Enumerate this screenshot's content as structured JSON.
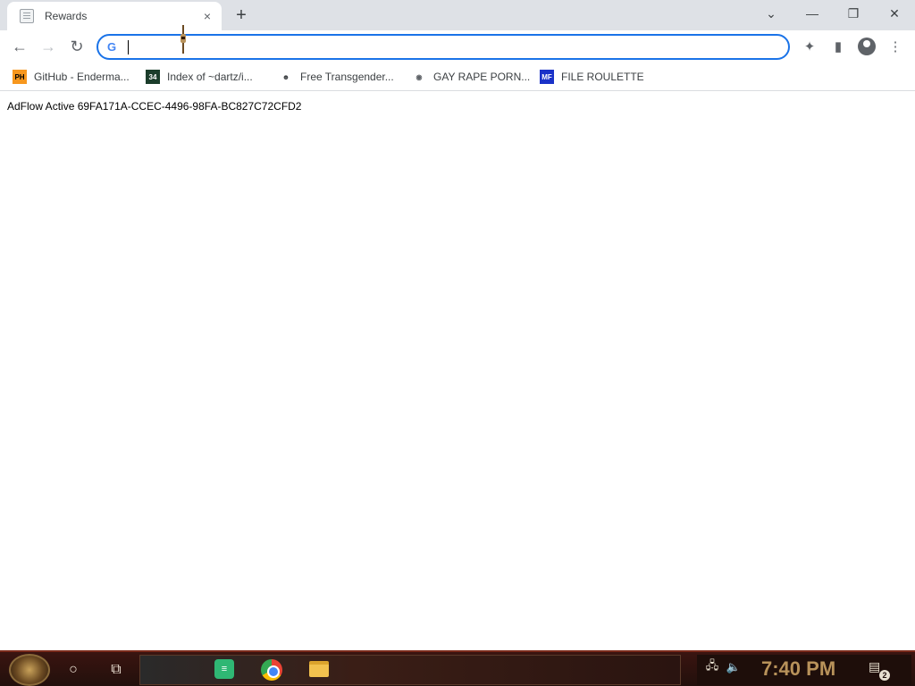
{
  "browser": {
    "tab": {
      "title": "Rewards",
      "close_icon": "×"
    },
    "new_tab_icon": "+",
    "window_controls": {
      "tab_search": "⌄",
      "minimize": "—",
      "restore": "❐",
      "close": "✕"
    },
    "toolbar": {
      "back_icon": "←",
      "forward_icon": "→",
      "reload_icon": "↻",
      "omnibox": {
        "value": "",
        "placeholder": ""
      },
      "extensions_icon": "✦",
      "side_panel_icon": "▮",
      "menu_icon": "⋮"
    },
    "bookmarks": [
      {
        "label": "GitHub - Enderma...",
        "icon_text": "PH",
        "icon_bg": "#f7971e",
        "icon_fg": "#000000"
      },
      {
        "label": "Index of ~dartz/i...",
        "icon_text": "34",
        "icon_bg": "#1b3d2b",
        "icon_fg": "#ffffff"
      },
      {
        "label": "Free Transgender...",
        "icon_text": "☻",
        "icon_bg": "#ffffff",
        "icon_fg": "#3c4043"
      },
      {
        "label": "GAY RAPE PORN...",
        "icon_text": "◉",
        "icon_bg": "#ffffff",
        "icon_fg": "#5f6368"
      },
      {
        "label": "FILE ROULETTE",
        "icon_text": "MF",
        "icon_bg": "#1a32c8",
        "icon_fg": "#ffffff"
      }
    ]
  },
  "page": {
    "text": "AdFlow Active 69FA171A-CCEC-4496-98FA-BC827C72CFD2"
  },
  "taskbar": {
    "search_icon": "○",
    "task_view_icon": "⧉",
    "notes_label": "≡",
    "clock": "7:40 PM",
    "network_icon": "🖧",
    "volume_icon": "🔈",
    "notifications_count": "2",
    "notification_icon": "▤"
  },
  "colors": {
    "accent": "#1a73e8",
    "tabstrip": "#dee1e6",
    "taskbar": "#2a120e",
    "clock": "#b8925a"
  }
}
